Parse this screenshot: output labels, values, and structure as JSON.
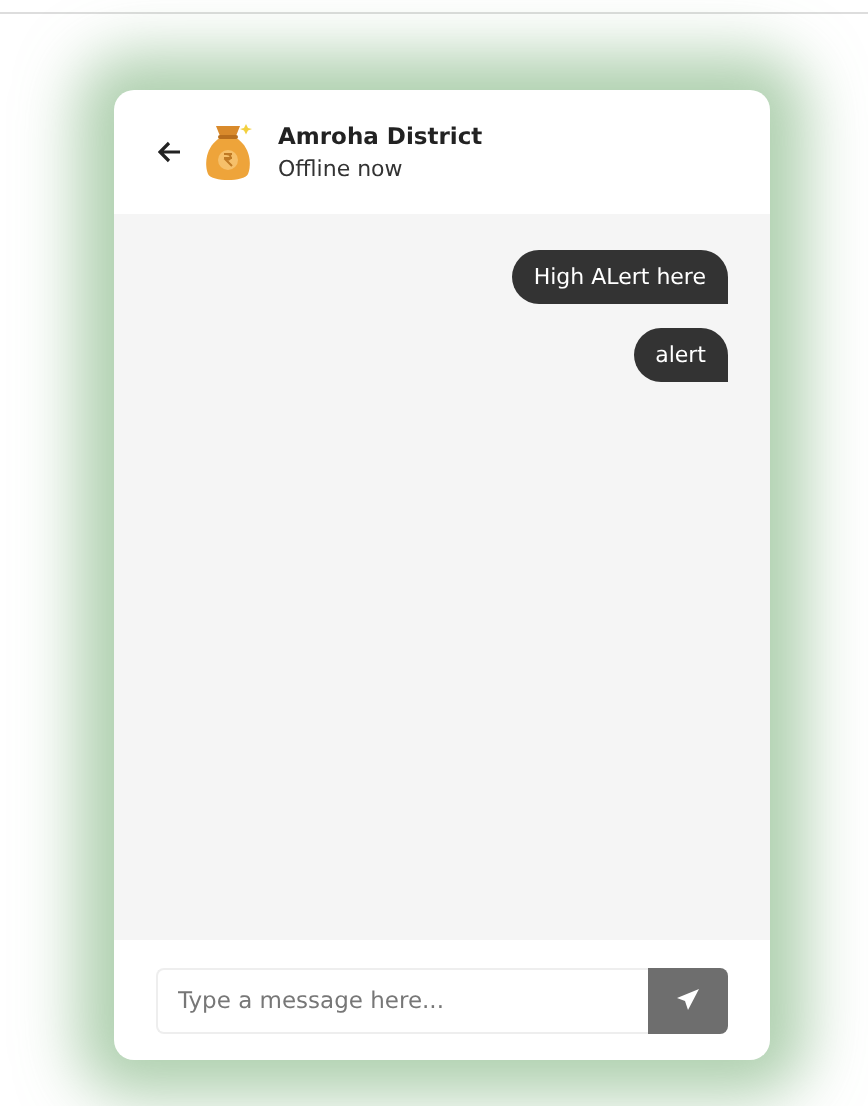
{
  "contact": {
    "name": "Amroha District",
    "status": "Offline now"
  },
  "messages": [
    {
      "text": "High ALert here",
      "outgoing": true
    },
    {
      "text": "alert",
      "outgoing": true
    }
  ],
  "composer": {
    "placeholder": "Type a message here..."
  }
}
